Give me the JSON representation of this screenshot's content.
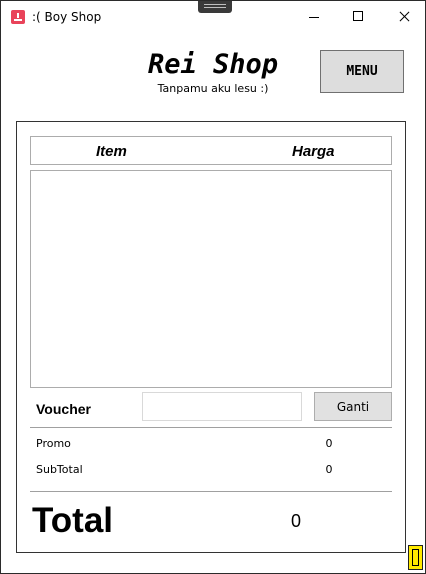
{
  "window": {
    "title": ":( Boy Shop"
  },
  "header": {
    "shop_name": "Rei Shop",
    "tagline": "Tanpamu aku lesu :)",
    "menu_label": "MENU"
  },
  "table": {
    "columns": [
      "Item",
      "Harga"
    ],
    "rows": []
  },
  "voucher": {
    "label": "Voucher",
    "input_value": "",
    "button_label": "Ganti"
  },
  "summary": {
    "promo_label": "Promo",
    "promo_value": "0",
    "subtotal_label": "SubTotal",
    "subtotal_value": "0",
    "total_label": "Total",
    "total_value": "0"
  },
  "colors": {
    "app_icon": "#e9435a",
    "button_bg": "#dddddd",
    "grip": "#ffea00"
  },
  "icons": [
    "app-icon",
    "minimize-icon",
    "maximize-icon",
    "close-icon",
    "resize-grip-icon"
  ]
}
